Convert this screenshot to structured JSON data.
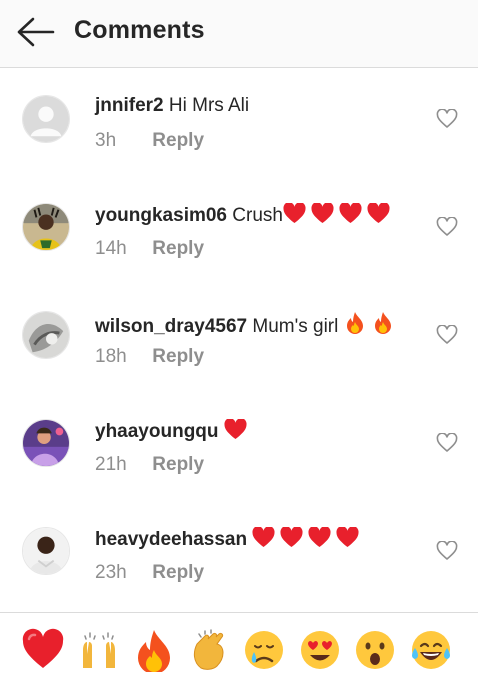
{
  "header": {
    "title": "Comments",
    "back_icon": "arrow-left-icon"
  },
  "comments": [
    {
      "username": "jnnifer2",
      "text": "Hi Mrs Ali",
      "emojis": [],
      "time": "3h",
      "reply_label": "Reply",
      "avatar": "default-avatar",
      "like_icon": "heart-outline-icon"
    },
    {
      "username": "youngkasim06",
      "text": "Crush",
      "emojis": [
        "red-heart",
        "red-heart",
        "red-heart",
        "red-heart"
      ],
      "time": "14h",
      "reply_label": "Reply",
      "avatar": "user-photo",
      "like_icon": "heart-outline-icon"
    },
    {
      "username": "wilson_dray4567",
      "text": "Mum's girl",
      "emojis": [
        "fire",
        "fire"
      ],
      "time": "18h",
      "reply_label": "Reply",
      "avatar": "user-photo",
      "like_icon": "heart-outline-icon"
    },
    {
      "username": "yhaayoungqu",
      "text": "",
      "emojis": [
        "red-heart"
      ],
      "time": "21h",
      "reply_label": "Reply",
      "avatar": "user-photo",
      "like_icon": "heart-outline-icon"
    },
    {
      "username": "heavydeehassan",
      "text": "",
      "emojis": [
        "red-heart",
        "red-heart",
        "red-heart",
        "red-heart"
      ],
      "time": "23h",
      "reply_label": "Reply",
      "avatar": "user-photo",
      "like_icon": "heart-outline-icon"
    }
  ],
  "emoji_bar": [
    "red-heart",
    "raising-hands",
    "fire",
    "clapping-hands",
    "crying-face",
    "heart-eyes-face",
    "surprised-face",
    "tears-of-joy-face"
  ],
  "colors": {
    "text": "#262626",
    "secondary": "#8e8e8e",
    "divider": "#dbdbdb",
    "heart_red": "#e8202c"
  }
}
